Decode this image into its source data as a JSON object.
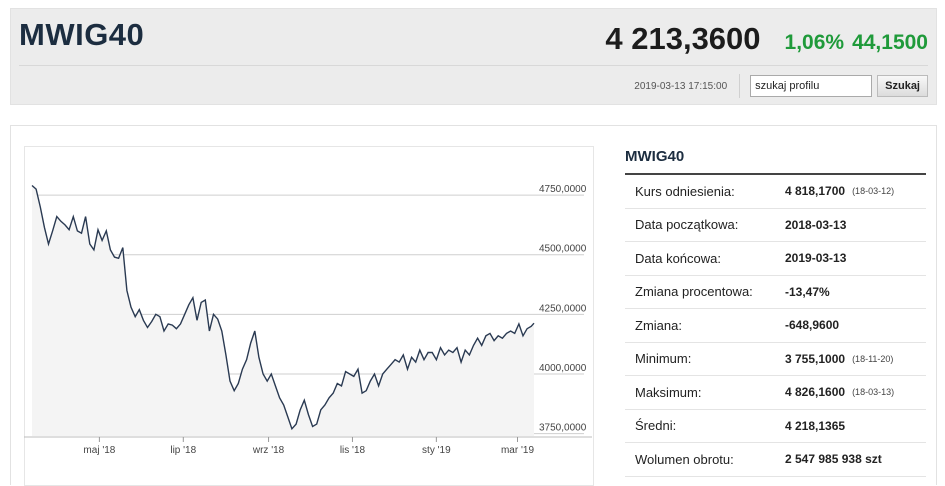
{
  "header": {
    "title": "MWIG40",
    "price": "4 213,3600",
    "change_pct": "1,06%",
    "change_abs": "44,1500",
    "timestamp": "2019-03-13 17:15:00",
    "search_value": "szukaj profilu",
    "search_button": "Szukaj"
  },
  "colors": {
    "accent": "#1c2d40",
    "positive": "#1f9a3a",
    "line": "#2a3a52",
    "area": "#f4f4f4"
  },
  "stats": {
    "title": "MWIG40",
    "rows": [
      {
        "label": "Kurs odniesienia:",
        "value": "4 818,1700",
        "date": "(18-03-12)"
      },
      {
        "label": "Data początkowa:",
        "value": "2018-03-13",
        "date": ""
      },
      {
        "label": "Data końcowa:",
        "value": "2019-03-13",
        "date": ""
      },
      {
        "label": "Zmiana procentowa:",
        "value": "-13,47%",
        "date": ""
      },
      {
        "label": "Zmiana:",
        "value": "-648,9600",
        "date": ""
      },
      {
        "label": "Minimum:",
        "value": "3 755,1000",
        "date": "(18-11-20)"
      },
      {
        "label": "Maksimum:",
        "value": "4 826,1600",
        "date": "(18-03-13)"
      },
      {
        "label": "Średni:",
        "value": "4 218,1365",
        "date": ""
      },
      {
        "label": "Wolumen obrotu:",
        "value": "2 547 985 938 szt",
        "date": ""
      }
    ]
  },
  "chart_data": {
    "type": "area",
    "x_tick_labels": [
      "maj '18",
      "lip '18",
      "wrz '18",
      "lis '18",
      "sty '19",
      "mar '19"
    ],
    "y_tick_labels": [
      "4750,0000",
      "4500,0000",
      "4250,0000",
      "4000,0000",
      "3750,0000"
    ],
    "y_ticks": [
      4750,
      4500,
      4250,
      4000,
      3750
    ],
    "ylim": [
      3740,
      4830
    ],
    "x_range": [
      0,
      365
    ],
    "x_tick_days": [
      49,
      110,
      172,
      233,
      294,
      353
    ],
    "grid": true,
    "series": [
      {
        "x": [
          0,
          3,
          6,
          9,
          12,
          15,
          18,
          21,
          24,
          27,
          30,
          33,
          36,
          39,
          42,
          45,
          48,
          51,
          54,
          57,
          60,
          63,
          66,
          69,
          72,
          75,
          78,
          81,
          84,
          87,
          90,
          93,
          96,
          99,
          102,
          105,
          108,
          111,
          114,
          117,
          120,
          123,
          126,
          129,
          132,
          135,
          138,
          141,
          144,
          147,
          150,
          153,
          156,
          159,
          162,
          165,
          168,
          171,
          174,
          177,
          180,
          183,
          186,
          189,
          192,
          195,
          198,
          201,
          204,
          207,
          210,
          213,
          216,
          219,
          222,
          225,
          228,
          231,
          234,
          237,
          240,
          243,
          246,
          249,
          252,
          255,
          258,
          261,
          264,
          267,
          270,
          273,
          276,
          279,
          282,
          285,
          288,
          291,
          294,
          297,
          300,
          303,
          306,
          309,
          312,
          315,
          318,
          321,
          324,
          327,
          330,
          333,
          336,
          339,
          342,
          345,
          348,
          351,
          354,
          357,
          360,
          363,
          365
        ],
        "y": [
          4790,
          4775,
          4700,
          4615,
          4545,
          4600,
          4660,
          4640,
          4625,
          4605,
          4660,
          4600,
          4590,
          4660,
          4545,
          4520,
          4605,
          4560,
          4600,
          4520,
          4490,
          4485,
          4530,
          4350,
          4280,
          4240,
          4270,
          4225,
          4195,
          4220,
          4250,
          4240,
          4180,
          4210,
          4205,
          4190,
          4210,
          4250,
          4290,
          4320,
          4225,
          4300,
          4310,
          4180,
          4250,
          4230,
          4180,
          4080,
          3970,
          3930,
          3960,
          4020,
          4060,
          4130,
          4180,
          4070,
          4000,
          3970,
          4000,
          3950,
          3900,
          3870,
          3820,
          3770,
          3790,
          3850,
          3890,
          3830,
          3780,
          3790,
          3850,
          3870,
          3900,
          3920,
          3960,
          3950,
          4010,
          4000,
          3990,
          4020,
          3920,
          3930,
          3970,
          4000,
          3950,
          4000,
          4020,
          4040,
          4060,
          4050,
          4080,
          4020,
          4070,
          4050,
          4100,
          4060,
          4090,
          4090,
          4060,
          4110,
          4080,
          4100,
          4090,
          4110,
          4050,
          4100,
          4080,
          4120,
          4150,
          4120,
          4160,
          4170,
          4140,
          4160,
          4150,
          4170,
          4180,
          4170,
          4210,
          4160,
          4190,
          4200,
          4213
        ]
      }
    ]
  }
}
